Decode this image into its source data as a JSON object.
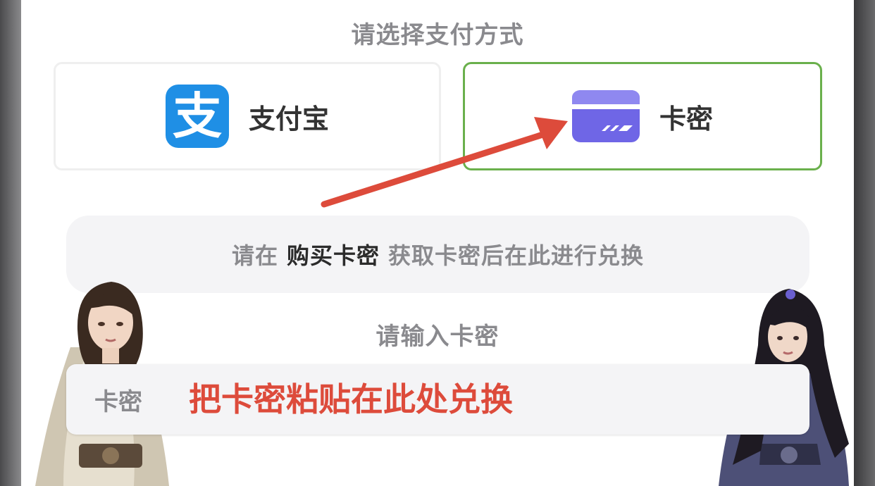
{
  "payment": {
    "title": "请选择支付方式",
    "options": [
      {
        "label": "支付宝",
        "icon": "alipay-icon",
        "icon_glyph": "支",
        "selected": false
      },
      {
        "label": "卡密",
        "icon": "card-icon",
        "selected": true
      }
    ]
  },
  "info": {
    "prefix": "请在",
    "link": "购买卡密",
    "suffix": "获取卡密后在此进行兑换"
  },
  "redeem": {
    "title": "请输入卡密",
    "field_label": "卡密",
    "placeholder": "把卡密粘贴在此处兑换"
  },
  "colors": {
    "selected_border": "#6ab04c",
    "arrow": "#dd4b3b",
    "alipay_blue": "#1f8fe5",
    "card_purple": "#6f66e6"
  }
}
